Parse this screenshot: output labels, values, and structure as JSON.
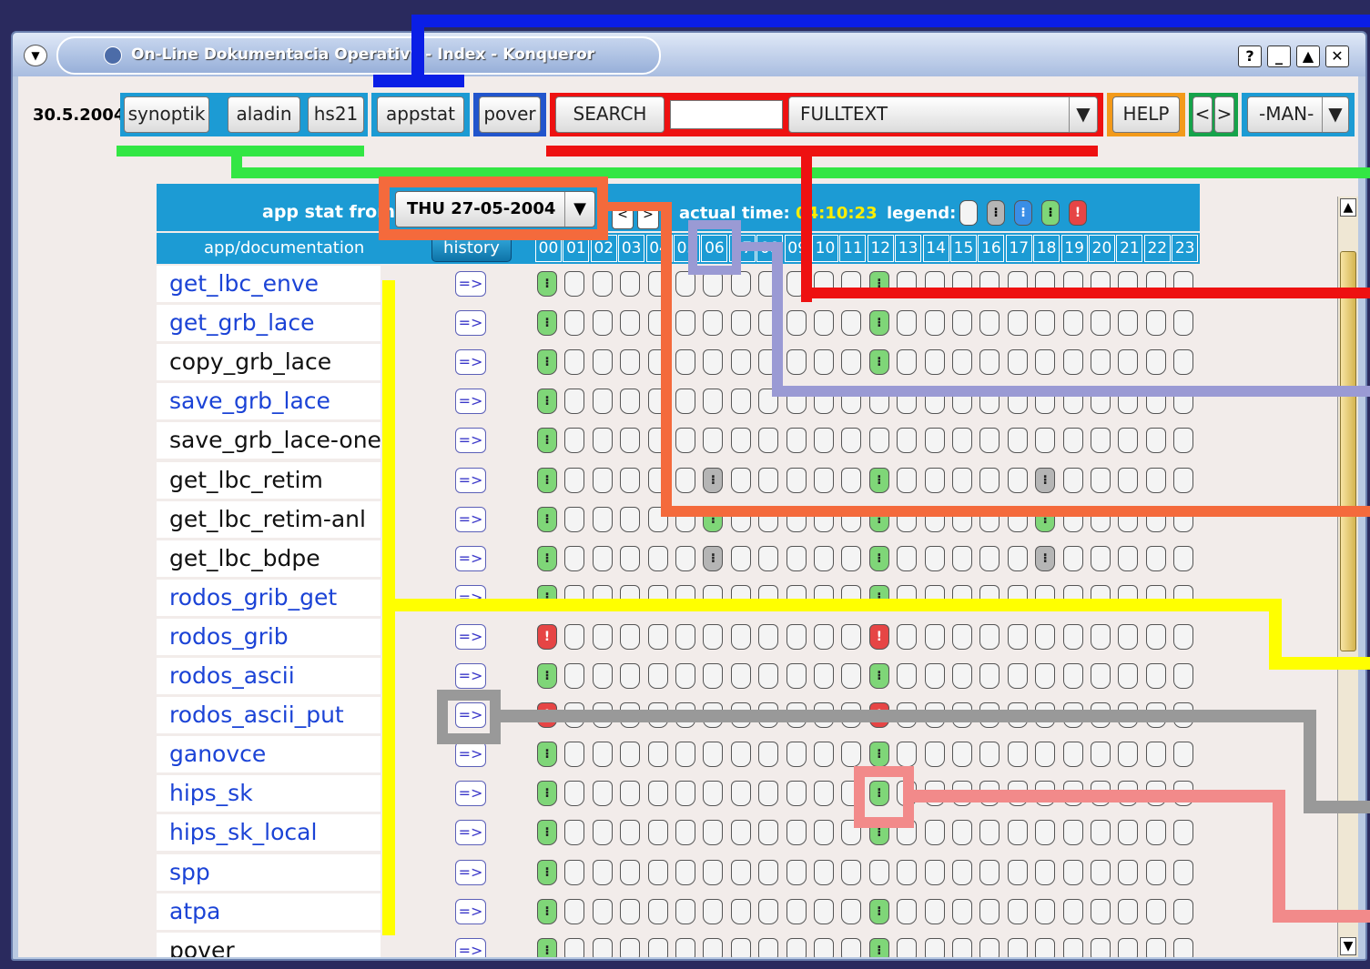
{
  "window": {
    "title": "On-Line Dokumentacia Operativy - Index - Konqueror"
  },
  "toolbar": {
    "date": "30.5.2004",
    "links": [
      "synoptik",
      "aladin",
      "hs21",
      "appstat",
      "pover"
    ],
    "search_label": "SEARCH",
    "search_value": "",
    "mode_value": "FULLTEXT",
    "help_label": "HELP",
    "prev_label": "<",
    "next_label": ">",
    "man_value": "-MAN-"
  },
  "table": {
    "title": "app stat from",
    "date_selected": "THU 27-05-2004",
    "actual_label": "actual time:",
    "actual_time": "04:10:23",
    "legend_label": "legend:",
    "col_app": "app/documentation",
    "history_label": "history",
    "hours": [
      "00",
      "01",
      "02",
      "03",
      "04",
      "05",
      "06",
      "07",
      "08",
      "09",
      "10",
      "11",
      "12",
      "13",
      "14",
      "15",
      "16",
      "17",
      "18",
      "19",
      "20",
      "21",
      "22",
      "23"
    ],
    "history_button_label": "=>",
    "rows": [
      {
        "name": "get_lbc_enve",
        "link": true,
        "status": {
          "0": "ok",
          "12": "ok"
        }
      },
      {
        "name": "get_grb_lace",
        "link": true,
        "status": {
          "0": "ok",
          "12": "ok"
        }
      },
      {
        "name": "copy_grb_lace",
        "link": false,
        "status": {
          "0": "ok",
          "12": "ok"
        }
      },
      {
        "name": "save_grb_lace",
        "link": true,
        "status": {
          "0": "ok"
        }
      },
      {
        "name": "save_grb_lace-one",
        "link": false,
        "status": {
          "0": "ok"
        }
      },
      {
        "name": "get_lbc_retim",
        "link": false,
        "status": {
          "0": "ok",
          "6": "warn",
          "12": "ok",
          "18": "warn"
        }
      },
      {
        "name": "get_lbc_retim-anl",
        "link": false,
        "status": {
          "0": "ok",
          "6": "ok",
          "12": "ok",
          "18": "ok"
        }
      },
      {
        "name": "get_lbc_bdpe",
        "link": false,
        "status": {
          "0": "ok",
          "6": "warn",
          "12": "ok",
          "18": "warn"
        }
      },
      {
        "name": "rodos_grib_get",
        "link": true,
        "status": {
          "0": "ok",
          "12": "ok"
        }
      },
      {
        "name": "rodos_grib",
        "link": true,
        "status": {
          "0": "err",
          "12": "err"
        }
      },
      {
        "name": "rodos_ascii",
        "link": true,
        "status": {
          "0": "ok",
          "12": "ok"
        }
      },
      {
        "name": "rodos_ascii_put",
        "link": true,
        "status": {
          "0": "err",
          "12": "err"
        }
      },
      {
        "name": "ganovce",
        "link": true,
        "status": {
          "0": "ok",
          "12": "ok"
        }
      },
      {
        "name": "hips_sk",
        "link": true,
        "status": {
          "0": "ok",
          "12": "ok"
        }
      },
      {
        "name": "hips_sk_local",
        "link": true,
        "status": {
          "0": "ok",
          "12": "ok"
        }
      },
      {
        "name": "spp",
        "link": true,
        "status": {
          "0": "ok"
        }
      },
      {
        "name": "atpa",
        "link": true,
        "status": {
          "0": "ok",
          "12": "ok"
        }
      },
      {
        "name": "pover",
        "link": false,
        "status": {
          "0": "ok",
          "12": "ok"
        }
      }
    ]
  },
  "colors": {
    "header": "#1c9bd4",
    "ok": "#7fd678",
    "err": "#e64545",
    "link": "#1b43d6"
  }
}
